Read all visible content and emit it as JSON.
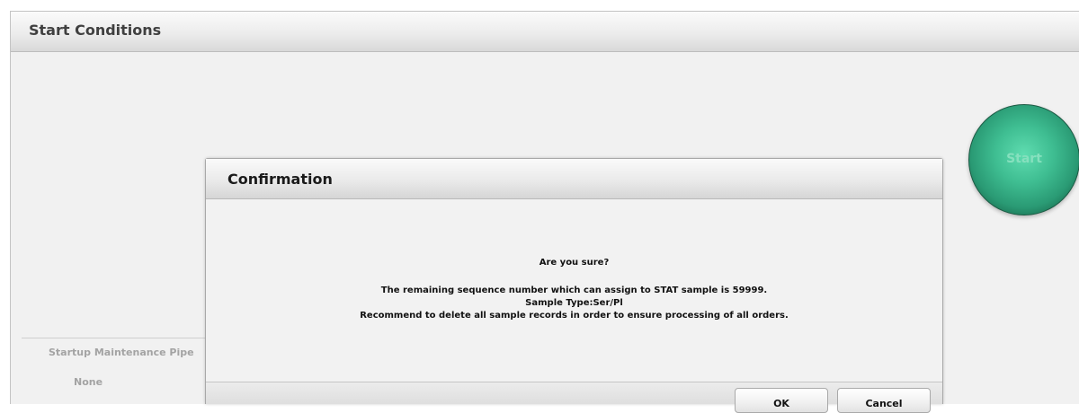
{
  "window": {
    "title": "Start Conditions"
  },
  "start_button": {
    "label": "Start"
  },
  "side_panel": {
    "pipe_label": "Startup Maintenance Pipe",
    "pipe_value": "None"
  },
  "dialog": {
    "title": "Confirmation",
    "question": "Are you sure?",
    "message_lines": [
      "The remaining sequence number which can assign to STAT sample is 59999.",
      "Sample Type:Ser/Pl",
      "Recommend to delete all sample records in order to ensure processing of all orders."
    ],
    "ok_label": "OK",
    "cancel_label": "Cancel"
  },
  "colors": {
    "start_button_green": "#3fbe92",
    "header_gray": "#e6e6e6",
    "background": "#f1f1f1"
  },
  "icons": {}
}
